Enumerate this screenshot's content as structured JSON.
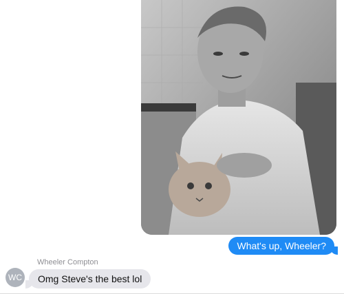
{
  "messages": {
    "outgoing": {
      "photo": {
        "subject": "Man in white shirt holding an orange tabby cat in a kitchen (black and white)"
      },
      "text": "What's up, Wheeler?"
    },
    "incoming": {
      "sender_name": "Wheeler Compton",
      "avatar_initials": "WC",
      "text": "Omg Steve's the best lol"
    }
  },
  "colors": {
    "outgoing_bubble": "#1f8bf5",
    "incoming_bubble": "#e6e6eb",
    "avatar": "#aeb3bb"
  }
}
